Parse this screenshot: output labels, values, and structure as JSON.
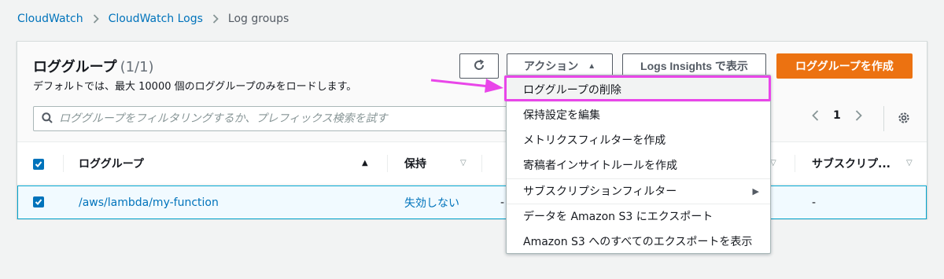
{
  "breadcrumb": {
    "items": [
      "CloudWatch",
      "CloudWatch Logs",
      "Log groups"
    ]
  },
  "panel": {
    "title": "ロググループ",
    "count": "(1/1)",
    "description": "デフォルトでは、最大 10000 個のロググループのみをロードします。"
  },
  "toolbar": {
    "actions_label": "アクション",
    "insights_label": "Logs Insights で表示",
    "create_label": "ロググループを作成"
  },
  "search": {
    "placeholder": "ロググループをフィルタリングするか、プレフィックス検索を試す"
  },
  "pagination": {
    "page": "1"
  },
  "table": {
    "columns": [
      "ロググループ",
      "保持",
      "サブスクリプ..."
    ],
    "rows": [
      {
        "name": "/aws/lambda/my-function",
        "retention": "失効しない",
        "col3": "-",
        "subscription": "-"
      }
    ]
  },
  "menu": {
    "items": [
      "ロググループの削除",
      "保持設定を編集",
      "メトリクスフィルターを作成",
      "寄稿者インサイトルールを作成",
      "サブスクリプションフィルター",
      "データを Amazon S3 にエクスポート",
      "Amazon S3 へのすべてのエクスポートを表示"
    ]
  },
  "colors": {
    "link": "#0073bb",
    "primary_button": "#ec7211",
    "highlight": "#e946e9",
    "selected_row": "#f1faff"
  }
}
